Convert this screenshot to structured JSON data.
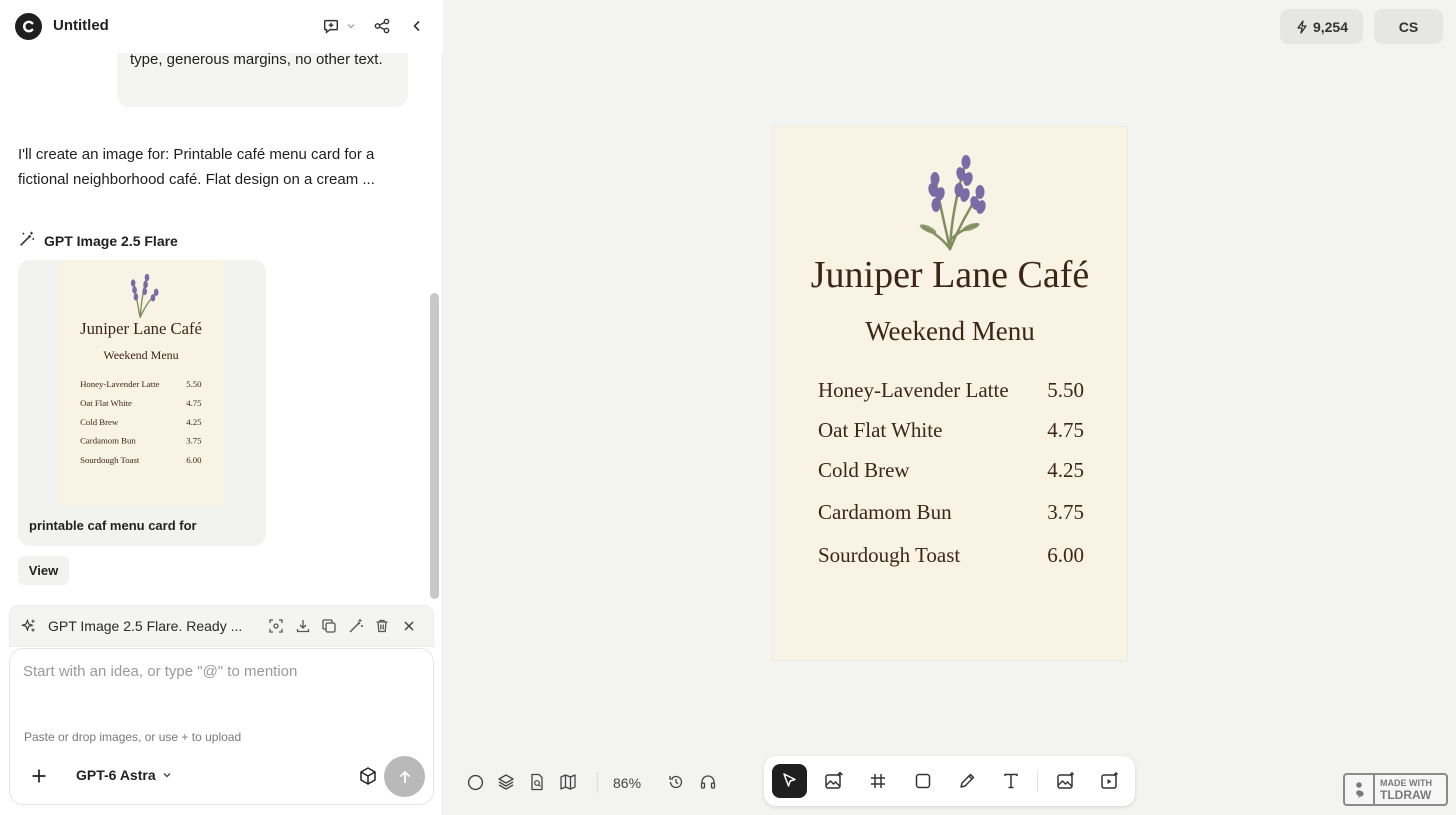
{
  "app": {
    "document_title": "Untitled",
    "credits": "9,254",
    "user_initials": "CS"
  },
  "chat": {
    "user_message_tail": "type, generous margins, no other text.",
    "assistant_message": "I'll create an image for: Printable café menu card for a fictional neighborhood café. Flat design on a cream ...",
    "model_used": "GPT Image 2.5 Flare",
    "thumbnail_caption": "printable caf menu card for",
    "view_label": "View"
  },
  "status": {
    "text": "GPT Image 2.5 Flare. Ready ..."
  },
  "composer": {
    "placeholder": "Start with an idea, or type \"@\" to mention",
    "hint": "Paste or drop images, or use + to upload",
    "model_selector": "GPT-6 Astra"
  },
  "canvas": {
    "zoom": "86%"
  },
  "menu_card": {
    "title": "Juniper Lane Café",
    "subtitle": "Weekend Menu",
    "items": [
      {
        "name": "Honey-Lavender Latte",
        "price": "5.50"
      },
      {
        "name": "Oat Flat White",
        "price": "4.75"
      },
      {
        "name": "Cold Brew",
        "price": "4.25"
      },
      {
        "name": "Cardamom Bun",
        "price": "3.75"
      },
      {
        "name": "Sourdough Toast",
        "price": "6.00"
      }
    ],
    "colors": {
      "background": "#f8f3e5",
      "text": "#3d2618",
      "lavender": "#7a6aa6",
      "stem": "#7f8f5d"
    }
  },
  "badge": {
    "line1": "MADE WITH",
    "line2": "TLDRAW"
  },
  "colors": {
    "accent_dark": "#1f1f1f",
    "canvas_bg": "#f3f3f2",
    "panel_bg": "#ffffff"
  }
}
